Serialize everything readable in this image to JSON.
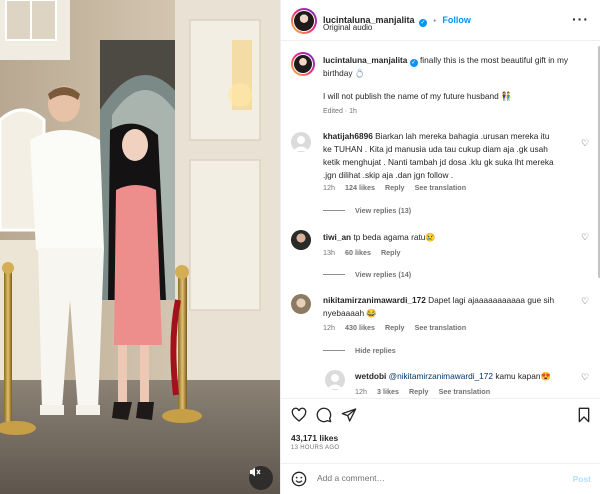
{
  "header": {
    "username": "lucintaluna_manjalita",
    "separator": "•",
    "follow_label": "Follow",
    "audio": "Original audio"
  },
  "caption": {
    "username": "lucintaluna_manjalita",
    "text": "finally this is the most beautiful gift in my birthday 💍",
    "text2": "I will not publish the name of my future husband 👫",
    "edited": "Edited · 1h"
  },
  "comments": [
    {
      "username": "khatijah6896",
      "text_lines": [
        "Biarkan lah mereka bahagia .urusan mereka itu",
        "ke TUHAN . Kita jd manusia uda tau cukup diam aja .gk usah",
        "ketik menghujat . Nanti tambah jd dosa .klu gk suka lht mereka",
        ".jgn dilihat .skip aja .dan jgn follow ."
      ],
      "age": "12h",
      "likes": "124 likes",
      "reply": "Reply",
      "translation": "See translation",
      "view_replies": "View replies (13)"
    },
    {
      "username": "tiwi_an",
      "text": "tp beda agama ratu😢",
      "age": "13h",
      "likes": "60 likes",
      "reply": "Reply",
      "view_replies": "View replies (14)"
    },
    {
      "username": "nikitamirzanimawardi_172",
      "text_lines": [
        "Dapet lagi ajaaaaaaaaaaa gue sih",
        "nyebaaaah 😂"
      ],
      "age": "12h",
      "likes": "430 likes",
      "reply": "Reply",
      "translation": "See translation",
      "hide_replies": "Hide replies"
    },
    {
      "username": "wetdobi",
      "mention": "@nikitamirzanimawardi_172",
      "text": "kamu kapan😍",
      "age": "12h",
      "likes": "3 likes",
      "reply": "Reply",
      "translation": "See translation"
    }
  ],
  "actions": {
    "like_icon": "heart-outline-icon",
    "comment_icon": "comment-icon",
    "share_icon": "paper-plane-icon",
    "save_icon": "bookmark-icon",
    "likes": "43,171 likes",
    "time_ago": "13 HOURS AGO"
  },
  "add_comment": {
    "placeholder": "Add a comment…",
    "post_label": "Post",
    "emoji_icon": "smiley-icon"
  },
  "media": {
    "audio_icon": "speaker-muted-icon"
  },
  "colors": {
    "accent": "#0095f6",
    "text": "#262626",
    "muted": "#737373",
    "border": "#efefef"
  }
}
